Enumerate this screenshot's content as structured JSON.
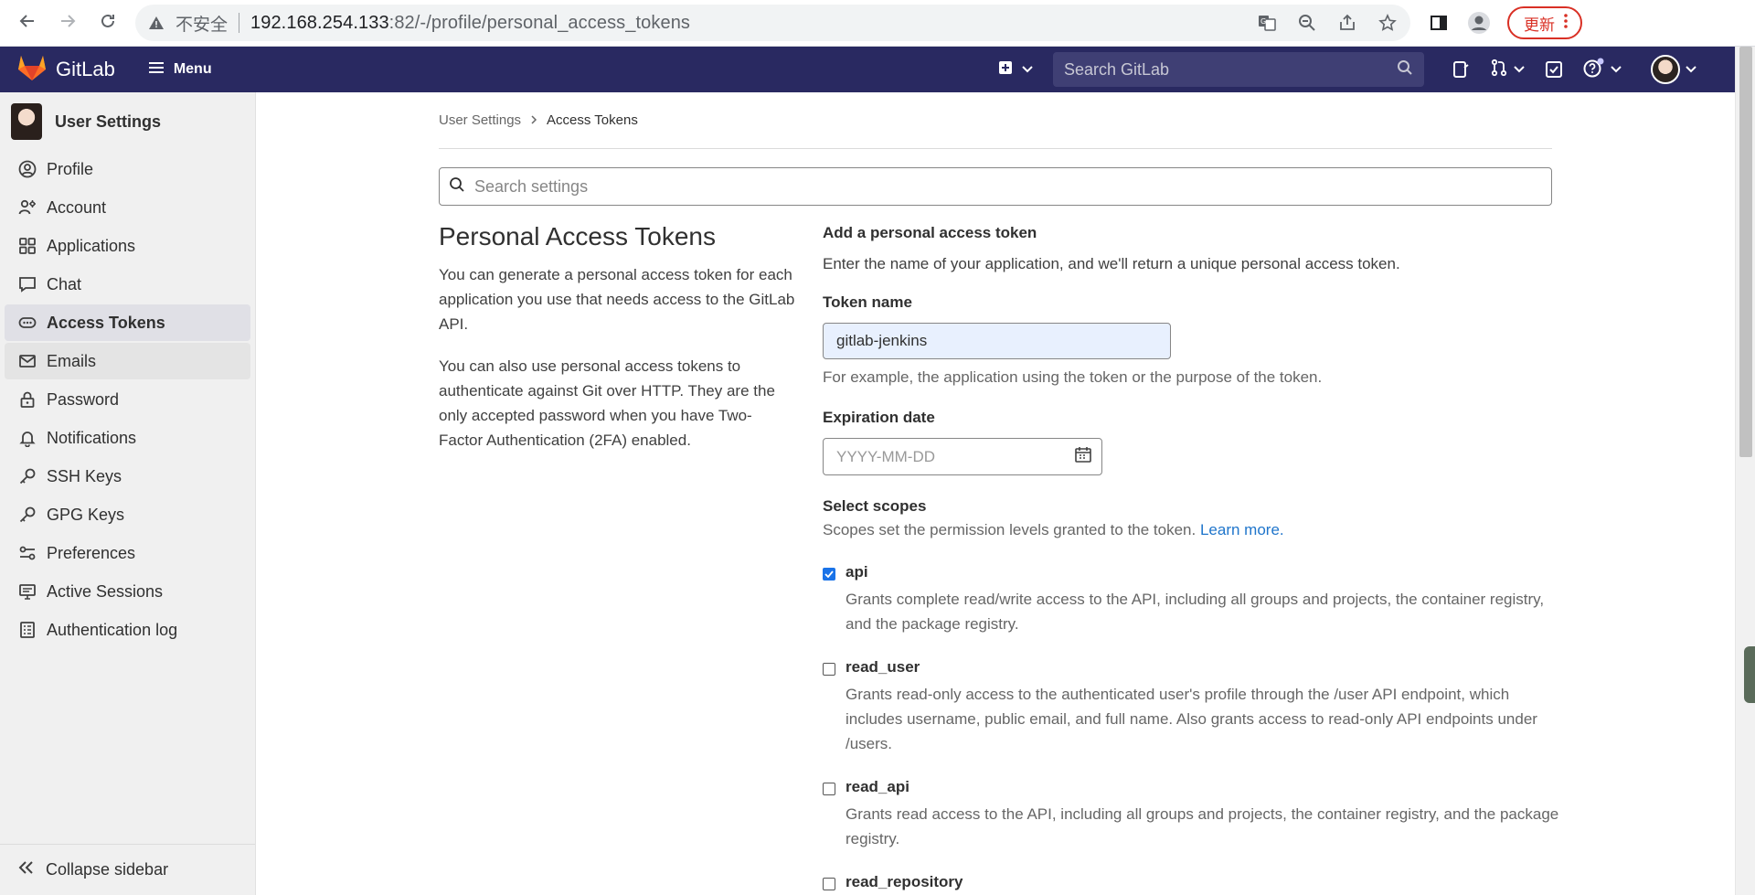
{
  "browser": {
    "insecure_label": "不安全",
    "url_host": "192.168.254.133",
    "url_rest": ":82/-/profile/personal_access_tokens",
    "update_label": "更新"
  },
  "header": {
    "brand": "GitLab",
    "menu_label": "Menu",
    "search_placeholder": "Search GitLab"
  },
  "sidebar": {
    "title": "User Settings",
    "items": [
      {
        "label": "Profile",
        "icon": "profile-icon"
      },
      {
        "label": "Account",
        "icon": "account-icon"
      },
      {
        "label": "Applications",
        "icon": "applications-icon"
      },
      {
        "label": "Chat",
        "icon": "chat-icon"
      },
      {
        "label": "Access Tokens",
        "icon": "token-icon"
      },
      {
        "label": "Emails",
        "icon": "mail-icon"
      },
      {
        "label": "Password",
        "icon": "lock-icon"
      },
      {
        "label": "Notifications",
        "icon": "bell-icon"
      },
      {
        "label": "SSH Keys",
        "icon": "key-icon"
      },
      {
        "label": "GPG Keys",
        "icon": "key-icon"
      },
      {
        "label": "Preferences",
        "icon": "preferences-icon"
      },
      {
        "label": "Active Sessions",
        "icon": "monitor-icon"
      },
      {
        "label": "Authentication log",
        "icon": "log-icon"
      }
    ],
    "collapse_label": "Collapse sidebar"
  },
  "breadcrumb": {
    "parent": "User Settings",
    "current": "Access Tokens"
  },
  "settings_search_placeholder": "Search settings",
  "intro": {
    "title": "Personal Access Tokens",
    "p1": "You can generate a personal access token for each application you use that needs access to the GitLab API.",
    "p2": "You can also use personal access tokens to authenticate against Git over HTTP. They are the only accepted password when you have Two-Factor Authentication (2FA) enabled."
  },
  "form": {
    "heading": "Add a personal access token",
    "description": "Enter the name of your application, and we'll return a unique personal access token.",
    "token_name_label": "Token name",
    "token_name_value": "gitlab-jenkins",
    "token_name_help": "For example, the application using the token or the purpose of the token.",
    "expiration_label": "Expiration date",
    "expiration_placeholder": "YYYY-MM-DD",
    "scopes_title": "Select scopes",
    "scopes_desc": "Scopes set the permission levels granted to the token.",
    "learn_more": "Learn more.",
    "scopes": [
      {
        "name": "api",
        "checked": true,
        "desc": "Grants complete read/write access to the API, including all groups and projects, the container registry, and the package registry."
      },
      {
        "name": "read_user",
        "checked": false,
        "desc": "Grants read-only access to the authenticated user's profile through the /user API endpoint, which includes username, public email, and full name. Also grants access to read-only API endpoints under /users."
      },
      {
        "name": "read_api",
        "checked": false,
        "desc": "Grants read access to the API, including all groups and projects, the container registry, and the package registry."
      },
      {
        "name": "read_repository",
        "checked": false,
        "desc": ""
      }
    ]
  }
}
